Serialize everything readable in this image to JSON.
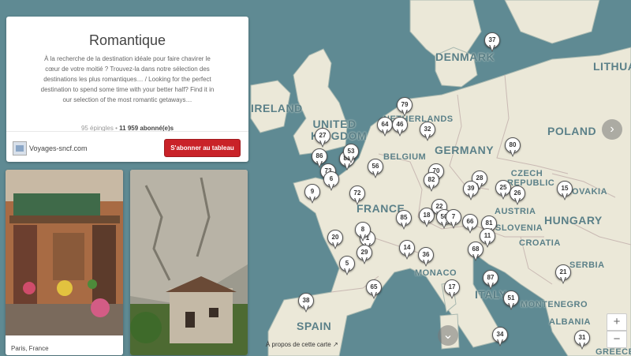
{
  "board": {
    "title": "Romantique",
    "description": "À la recherche de la destination idéale pour faire chavirer le cœur de votre moitié ? Trouvez-la dans notre sélection des destinations les plus romantiques… / Looking for the perfect destination to spend some time with your better half? Find it in our selection of the most romantic getaways…",
    "pins_count": "95 épingles",
    "separator": "•",
    "followers": "11 959 abonné(e)s",
    "owner": "Voyages-sncf.com",
    "subscribe_label": "S'abonner au tableau"
  },
  "pins": [
    {
      "caption": "Paris, France"
    },
    {
      "caption": ""
    }
  ],
  "map": {
    "attribution": "À propos de cette carte",
    "zoom_in": "+",
    "zoom_out": "−",
    "next_icon": "arrow-right-icon",
    "down_icon": "arrow-down-icon",
    "countries": [
      "IRELAND",
      "UNITED KINGDOM",
      "DENMARK",
      "LITHUA",
      "NETHERLANDS",
      "BELGIUM",
      "GERMANY",
      "POLAND",
      "CZECH REPUBLIC",
      "SLOVAKIA",
      "AUSTRIA",
      "HUNGARY",
      "FRANCE",
      "SLOVENIA",
      "CROATIA",
      "SERBIA",
      "MONACO",
      "ITALY",
      "MONTENEGRO",
      "ALBANIA",
      "SPAIN",
      "GREECE"
    ],
    "markers": [
      "37",
      "79",
      "64",
      "46",
      "32",
      "27",
      "86",
      "83",
      "53",
      "56",
      "73",
      "6",
      "9",
      "72",
      "70",
      "82",
      "28",
      "39",
      "25",
      "26",
      "15",
      "80",
      "85",
      "18",
      "22",
      "50",
      "7",
      "66",
      "81",
      "11",
      "1",
      "20",
      "5",
      "29",
      "14",
      "36",
      "68",
      "21",
      "17",
      "87",
      "51",
      "65",
      "38",
      "34",
      "31",
      "8"
    ]
  },
  "colors": {
    "sea": "#5f8a93",
    "land": "#ebe8d8",
    "subscribe": "#c92228"
  }
}
